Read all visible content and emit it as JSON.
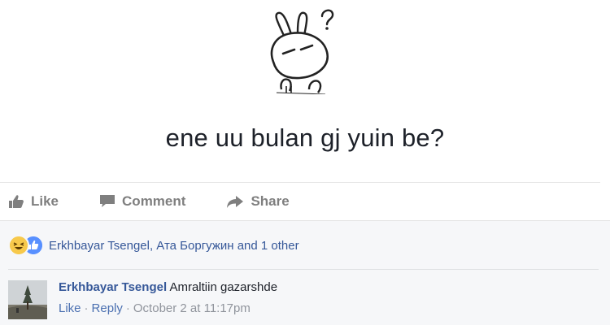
{
  "post": {
    "text": "ene uu bulan gj yuin be?"
  },
  "actions": {
    "like_label": "Like",
    "comment_label": "Comment",
    "share_label": "Share"
  },
  "reactions": {
    "icons": [
      "haha-reaction-icon",
      "like-reaction-icon"
    ],
    "names_text": "Erkhbayar Tsengel, Ата Боргужин and 1 other"
  },
  "comment": {
    "author": "Erkhbayar Tsengel",
    "text": "Amraltiin gazarshde",
    "like_label": "Like",
    "reply_label": "Reply",
    "timestamp": "October 2 at 11:17pm"
  },
  "colors": {
    "link": "#365899",
    "action_gray": "#7f7f7f",
    "feedback_bg": "#f6f7f9",
    "meta_gray": "#90949c",
    "like_blue": "#5890ff"
  }
}
